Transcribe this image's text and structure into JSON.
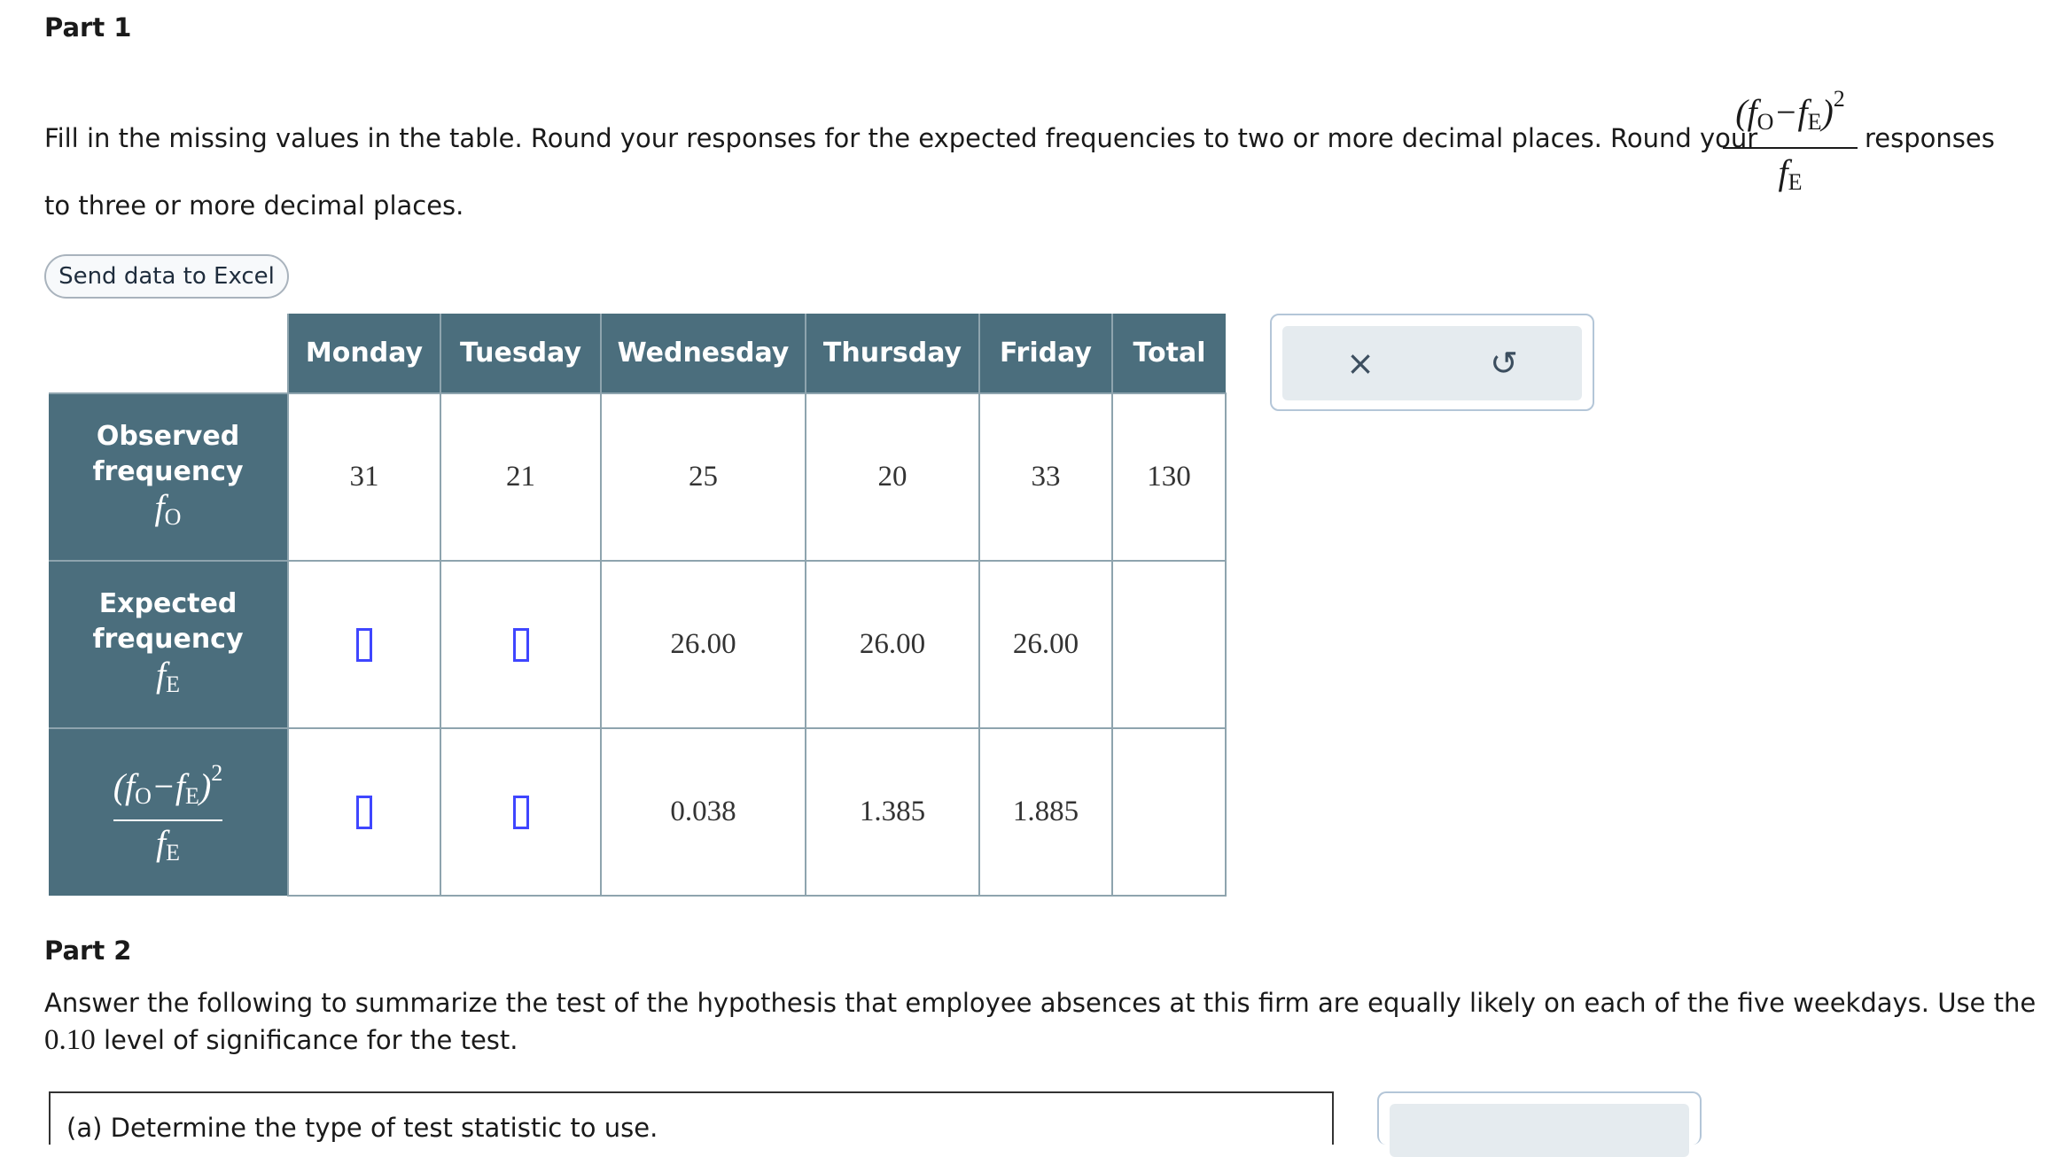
{
  "part1": {
    "title": "Part 1",
    "instructions_a": "Fill in the missing values in the table. Round your responses for the expected frequencies to two or more decimal places. Round your",
    "instructions_b": "responses",
    "instructions_c": "to three or more decimal places.",
    "excel_button": "Send data to Excel"
  },
  "table": {
    "columns": [
      "Monday",
      "Tuesday",
      "Wednesday",
      "Thursday",
      "Friday",
      "Total"
    ],
    "rows": [
      {
        "label_line1": "Observed",
        "label_line2": "frequency",
        "values": [
          "31",
          "21",
          "25",
          "20",
          "33",
          "130"
        ]
      },
      {
        "label_line1": "Expected",
        "label_line2": "frequency",
        "values": [
          "",
          "",
          "26.00",
          "26.00",
          "26.00",
          ""
        ]
      },
      {
        "values": [
          "",
          "",
          "0.038",
          "1.385",
          "1.885",
          ""
        ]
      }
    ]
  },
  "tools": {
    "clear": "×",
    "undo": "↺"
  },
  "part2": {
    "title": "Part 2",
    "text_a": "Answer the following to summarize the test of the hypothesis that employee absences at this firm are equally likely on each of the five weekdays. Use the",
    "level": "0.10",
    "text_b": "level of significance for the test.",
    "question_a": "(a)  Determine the type of test statistic to use."
  }
}
